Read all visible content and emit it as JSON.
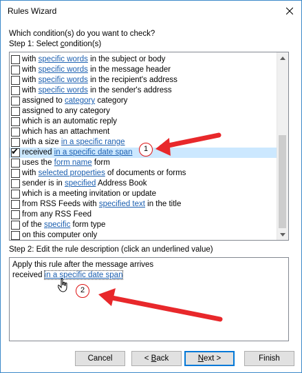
{
  "window": {
    "title": "Rules Wizard"
  },
  "prompt": "Which condition(s) do you want to check?",
  "step1": {
    "pre": "Step 1: Select ",
    "u": "c",
    "post": "ondition(s)"
  },
  "conditions": [
    {
      "checked": false,
      "pre": "with ",
      "link": "specific words",
      "post": " in the subject or body"
    },
    {
      "checked": false,
      "pre": "with ",
      "link": "specific words",
      "post": " in the message header"
    },
    {
      "checked": false,
      "pre": "with ",
      "link": "specific words",
      "post": " in the recipient's address"
    },
    {
      "checked": false,
      "pre": "with ",
      "link": "specific words",
      "post": " in the sender's address"
    },
    {
      "checked": false,
      "pre": "assigned to ",
      "link": "category",
      "post": " category"
    },
    {
      "checked": false,
      "pre": "assigned to any category",
      "link": "",
      "post": ""
    },
    {
      "checked": false,
      "pre": "which is an automatic reply",
      "link": "",
      "post": ""
    },
    {
      "checked": false,
      "pre": "which has an attachment",
      "link": "",
      "post": ""
    },
    {
      "checked": false,
      "pre": "with a size ",
      "link": "in a specific range",
      "post": ""
    },
    {
      "checked": true,
      "pre": "received ",
      "link": "in a specific date span",
      "post": "",
      "selected": true
    },
    {
      "checked": false,
      "pre": "uses the ",
      "link": "form name",
      "post": " form"
    },
    {
      "checked": false,
      "pre": "with ",
      "link": "selected properties",
      "post": " of documents or forms"
    },
    {
      "checked": false,
      "pre": "sender is in ",
      "link": "specified",
      "post": " Address Book"
    },
    {
      "checked": false,
      "pre": "which is a meeting invitation or update",
      "link": "",
      "post": ""
    },
    {
      "checked": false,
      "pre": "from RSS Feeds with ",
      "link": "specified text",
      "post": " in the title"
    },
    {
      "checked": false,
      "pre": "from any RSS Feed",
      "link": "",
      "post": ""
    },
    {
      "checked": false,
      "pre": "of the ",
      "link": "specific",
      "post": " form type"
    },
    {
      "checked": false,
      "pre": "on this computer only",
      "link": "",
      "post": ""
    }
  ],
  "step2": {
    "label": "Step 2: Edit the rule description (click an underlined value)"
  },
  "description": {
    "line1": "Apply this rule after the message arrives",
    "line2_pre": "received ",
    "line2_link": "in a specific date span"
  },
  "buttons": {
    "cancel": "Cancel",
    "back": {
      "pre": "< ",
      "u": "B",
      "post": "ack"
    },
    "next": {
      "u": "N",
      "post": "ext >"
    },
    "finish": "Finish"
  },
  "annotations": {
    "badge1": "1",
    "badge2": "2",
    "arrow_color": "#e8282b"
  },
  "colors": {
    "link": "#1b5fb0",
    "selection": "#cce8ff",
    "border": "#3a88c8"
  }
}
